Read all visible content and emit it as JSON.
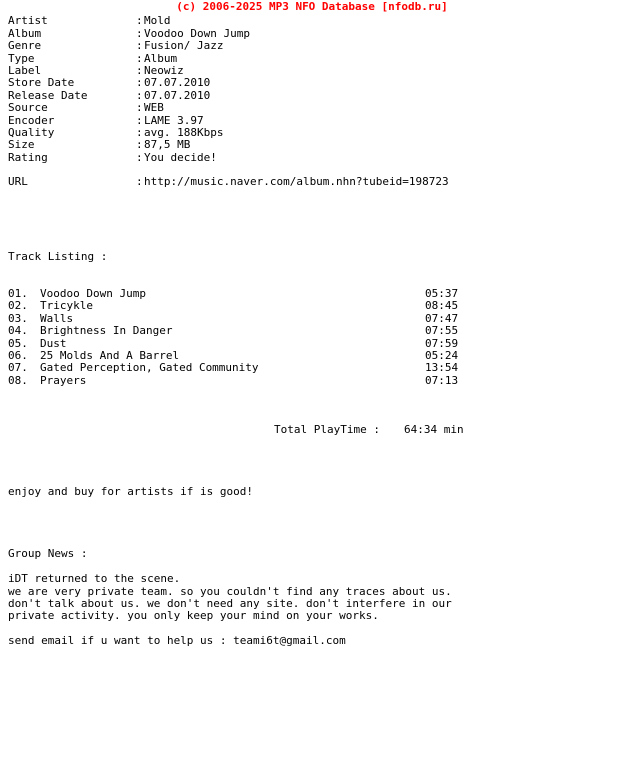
{
  "banner": {
    "text": "(c) 2006-2025 MP3 NFO Database [nfodb.ru]",
    "color": "#ff0000"
  },
  "info": {
    "separator": ":",
    "fields": [
      {
        "label": "Artist",
        "value": "Mold"
      },
      {
        "label": "Album",
        "value": "Voodoo Down Jump"
      },
      {
        "label": "Genre",
        "value": "Fusion/ Jazz"
      },
      {
        "label": "Type",
        "value": "Album"
      },
      {
        "label": "Label",
        "value": "Neowiz"
      },
      {
        "label": "Store Date",
        "value": "07.07.2010"
      },
      {
        "label": "Release Date",
        "value": "07.07.2010"
      },
      {
        "label": "Source",
        "value": "WEB"
      },
      {
        "label": "Encoder",
        "value": "LAME 3.97"
      },
      {
        "label": "Quality",
        "value": "avg. 188Kbps"
      },
      {
        "label": "Size",
        "value": "87,5 MB"
      },
      {
        "label": "Rating",
        "value": "You decide!"
      }
    ],
    "url_field": {
      "label": "URL",
      "value": "http://music.naver.com/album.nhn?tubeid=198723"
    }
  },
  "tracklist": {
    "heading": "Track Listing :",
    "tracks": [
      {
        "num": "01.",
        "title": "Voodoo Down Jump",
        "time": "05:37"
      },
      {
        "num": "02.",
        "title": "Tricykle",
        "time": "08:45"
      },
      {
        "num": "03.",
        "title": "Walls",
        "time": "07:47"
      },
      {
        "num": "04.",
        "title": "Brightness In Danger",
        "time": "07:55"
      },
      {
        "num": "05.",
        "title": "Dust",
        "time": "07:59"
      },
      {
        "num": "06.",
        "title": "25 Molds And A Barrel",
        "time": "05:24"
      },
      {
        "num": "07.",
        "title": "Gated Perception, Gated Community",
        "time": "13:54"
      },
      {
        "num": "08.",
        "title": "Prayers",
        "time": "07:13"
      }
    ],
    "total_label": "Total PlayTime :",
    "total_value": "64:34 min"
  },
  "message": {
    "line": "enjoy and buy for artists if is good!"
  },
  "group_news": {
    "heading": "Group News :",
    "lines": [
      "iDT returned to the scene.",
      "we are very private team. so you couldn't find any traces about us.",
      "don't talk about us. we don't need any site. don't interfere in our",
      "private activity. you only keep your mind on your works."
    ],
    "contact": "send email if u want to help us : teami6t@gmail.com"
  }
}
